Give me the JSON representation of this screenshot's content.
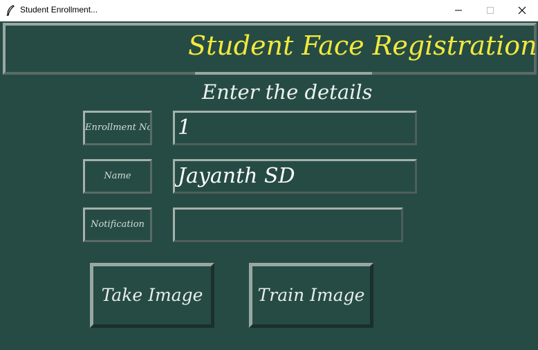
{
  "window": {
    "title": "Student Enrollment..."
  },
  "header": {
    "title": "Student Face Registration"
  },
  "subtitle": "Enter the details",
  "form": {
    "enrollment_label": "Enrollment No",
    "enrollment_value": "1",
    "name_label": "Name",
    "name_value": "Jayanth SD",
    "notification_label": "Notification",
    "notification_value": ""
  },
  "buttons": {
    "take_image": "Take Image",
    "train_image": "Train Image"
  },
  "colors": {
    "background": "#264b45",
    "header_title": "#f2e93c",
    "border_light": "#9aa7a1",
    "text": "#eef2ef"
  },
  "icons": {
    "app": "feather-icon",
    "minimize": "minimize-icon",
    "maximize": "maximize-icon",
    "close": "close-icon"
  }
}
